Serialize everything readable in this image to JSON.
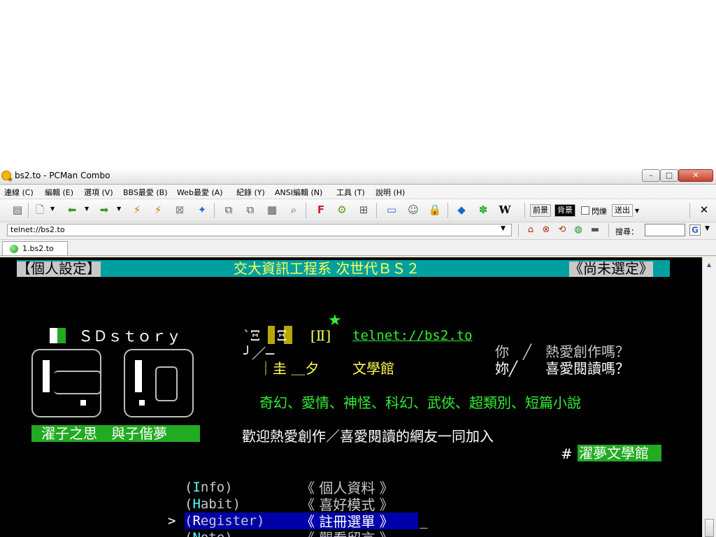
{
  "window": {
    "title": "bs2.to - PCMan Combo",
    "min_label": "–",
    "max_label": "□",
    "close_label": "✕"
  },
  "menu": [
    "連線 (C)",
    "編輯 (E)",
    "選項 (V)",
    "BBS最愛 (B)",
    "Web最愛 (A)",
    "紀錄 (Y)",
    "ANSI編輯 (N)",
    "工具 (T)",
    "說明 (H)"
  ],
  "toolbar": {
    "icons": [
      "site-list-icon",
      "new-connection-icon",
      "back-icon",
      "forward-icon",
      "disconnect-icon",
      "reconnect-icon",
      "close-tab-icon",
      "add-favorite-icon",
      "copy-icon",
      "paste-icon",
      "copy-ansi-icon",
      "find-icon",
      "font-icon",
      "settings-icon",
      "fullscreen-icon",
      "monitor-icon",
      "emoticon-icon",
      "lock-icon",
      "bbs-icon",
      "plurk-icon",
      "wikipedia-icon"
    ],
    "fg_label": "前景",
    "bg_label": "背景",
    "blink_label": "閃爍",
    "send_label": "送出",
    "close_label": "✕"
  },
  "address": {
    "value": "telnet://bs2.to",
    "search_label": "搜尋：",
    "search_value": ""
  },
  "tabs": [
    {
      "label": "1.bs2.to"
    }
  ],
  "terminal": {
    "header_left": "【個人設定】",
    "header_center": "交大資訊工程系 次世代ＢＳ２",
    "header_right": "《尚未選定》",
    "logo_text": "ＳＤｓｔｏｒｙ",
    "logo_caption": "濯子之思　與子偕夢",
    "deco_star": "★",
    "deco_line1": "`Ξ",
    "deco_line1b": "Ξ",
    "deco_bracket": "[Ⅱ]",
    "url": "telnet://bs2.to",
    "deco_line2": "╯／─",
    "deco_line3": "｜圭 ＿夕",
    "lit_hall": "文學館",
    "q1_a": "你　╱",
    "q1_b": "熱愛創作嗎？",
    "q2_a": "妳╱",
    "q2_b": "喜愛閱讀嗎？",
    "genres": "奇幻、愛情、神怪、科幻、武俠、超類別、短篇小說",
    "welcome": "歡迎熱愛創作／喜愛閱讀的網友一同加入",
    "hash": "#",
    "hall_name": "濯夢文學館",
    "menu_items": [
      {
        "key": "I",
        "rest": "nfo",
        "desc": "《 個人資料 》",
        "selected": false
      },
      {
        "key": "H",
        "rest": "abit",
        "desc": "《 喜好模式 》",
        "selected": false
      },
      {
        "key": "R",
        "rest": "egister",
        "desc": "《 註冊選單 》",
        "selected": true
      },
      {
        "key": "N",
        "rest": "ote",
        "desc": "《 觀看留言 》",
        "selected": false
      }
    ],
    "cursor_mark": ">",
    "cursor": "_"
  },
  "colors": {
    "terminal_bg": "#000000",
    "header_bg": "#00a0a0",
    "header_text": "#ffff55",
    "green": "#33ee33",
    "lime_bg": "#22aa22",
    "white": "#ffffff",
    "gray": "#c8c8c8",
    "cyan": "#55ffff",
    "menu_highlight": "#0000aa"
  }
}
